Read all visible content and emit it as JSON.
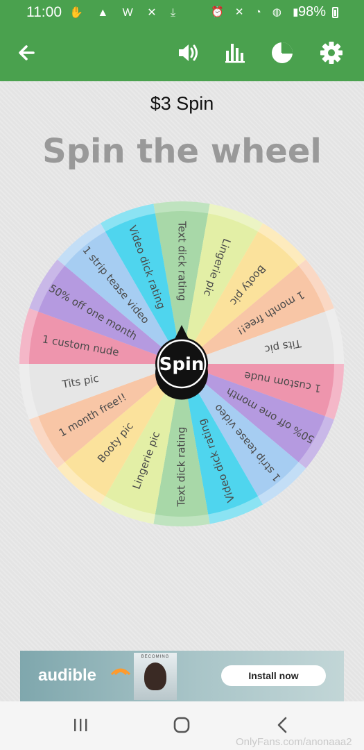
{
  "status_bar": {
    "time": "11:00",
    "left_icons_text": "✋ ▲ W ✕ ⤓",
    "right_icons_text": "⏰ ✕ ◔ ◍ ▮",
    "battery": "98%"
  },
  "app_bar": {
    "icons": [
      "back-arrow-icon",
      "volume-icon",
      "bar-chart-icon",
      "pie-chart-icon",
      "gear-icon"
    ]
  },
  "header": {
    "price": "$3 Spin",
    "title": "Spin the wheel"
  },
  "wheel": {
    "spin_label": "Spin",
    "segments": [
      {
        "label": "Text dick rating",
        "color": "#a8d8a8",
        "rim": "#bfe3bf"
      },
      {
        "label": "Lingerie pic",
        "color": "#e3efa6",
        "rim": "#ecf4c4"
      },
      {
        "label": "Booty pic",
        "color": "#fbe29c",
        "rim": "#fdebbd"
      },
      {
        "label": "1 month free!!",
        "color": "#f8c6a6",
        "rim": "#fad8c4"
      },
      {
        "label": "Tits pic",
        "color": "#e6e6e6",
        "rim": "#ededed"
      },
      {
        "label": "1 custom nude",
        "color": "#ee95ad",
        "rim": "#f4b7c8"
      },
      {
        "label": "50% off one month",
        "color": "#b59ae0",
        "rim": "#c9b8e8"
      },
      {
        "label": "1 strip tease video",
        "color": "#a6cdf2",
        "rim": "#c3def6"
      },
      {
        "label": "Video dick rating",
        "color": "#4fd5ee",
        "rim": "#8be3f3"
      },
      {
        "label": "Text dick rating",
        "color": "#a8d8a8",
        "rim": "#bfe3bf"
      },
      {
        "label": "Lingerie pic",
        "color": "#e3efa6",
        "rim": "#ecf4c4"
      },
      {
        "label": "Booty pic",
        "color": "#fbe29c",
        "rim": "#fdebbd"
      },
      {
        "label": "1 month free!!",
        "color": "#f8c6a6",
        "rim": "#fad8c4"
      },
      {
        "label": "Tits pic",
        "color": "#e6e6e6",
        "rim": "#ededed"
      },
      {
        "label": "1 custom nude",
        "color": "#ee95ad",
        "rim": "#f4b7c8"
      },
      {
        "label": "50% off one month",
        "color": "#b59ae0",
        "rim": "#c9b8e8"
      },
      {
        "label": "1 strip tease video",
        "color": "#a6cdf2",
        "rim": "#c3def6"
      },
      {
        "label": "Video dick rating",
        "color": "#4fd5ee",
        "rim": "#8be3f3"
      }
    ]
  },
  "ad": {
    "brand": "audible",
    "book_label": "BECOMING",
    "cta": "Install now"
  },
  "nav_bar": {
    "icons": [
      "recent-apps-icon",
      "home-icon",
      "back-icon"
    ]
  },
  "watermark": "OnlyFans.com/anonaaa2",
  "colors": {
    "app_bar": "#4aa14e",
    "background": "#e4e4e4",
    "title_gray": "#999999"
  }
}
